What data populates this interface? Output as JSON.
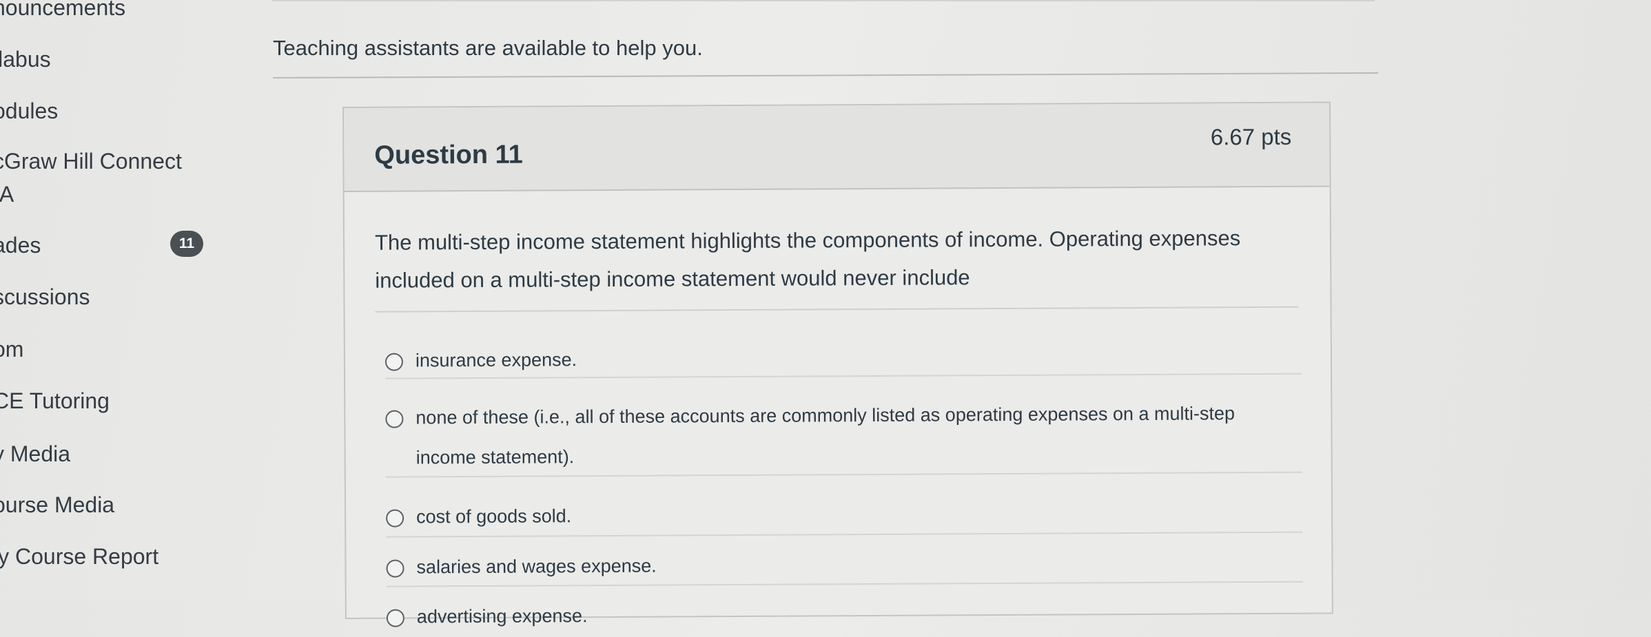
{
  "nav": {
    "items": [
      {
        "label": "nouncements"
      },
      {
        "label": "llabus"
      },
      {
        "label": "odules"
      },
      {
        "label": "cGraw Hill Connect"
      },
      {
        "label": "IA"
      },
      {
        "label": "ades",
        "badge": "11"
      },
      {
        "label": "scussions"
      },
      {
        "label": "om"
      },
      {
        "label": "CE Tutoring"
      },
      {
        "label": "y Media"
      },
      {
        "label": "ourse Media"
      },
      {
        "label": "ly Course Report"
      }
    ]
  },
  "notice": {
    "text": "Teaching assistants are available to help you."
  },
  "question": {
    "title": "Question 11",
    "points": "6.67 pts",
    "text": "The multi-step income statement highlights the components of income.  Operating expenses included on a multi-step income statement would never include",
    "answers": [
      {
        "label": "insurance expense."
      },
      {
        "label": "none of these (i.e., all of these accounts are commonly listed as operating expenses on a multi-step income statement)."
      },
      {
        "label": "cost of goods sold."
      },
      {
        "label": "salaries and wages expense."
      },
      {
        "label": "advertising expense."
      }
    ]
  }
}
